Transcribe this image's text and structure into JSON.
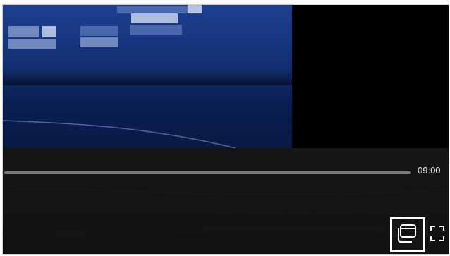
{
  "player": {
    "time_remaining": "09:00",
    "progress": 0.0
  },
  "controls": {
    "pip_icon": "picture-in-picture-icon",
    "fullscreen_icon": "fullscreen-icon"
  },
  "colors": {
    "video_blue": "#16357e",
    "controls_bg": "#141415",
    "track": "#7b7b7e",
    "highlight": "#ffffff"
  }
}
